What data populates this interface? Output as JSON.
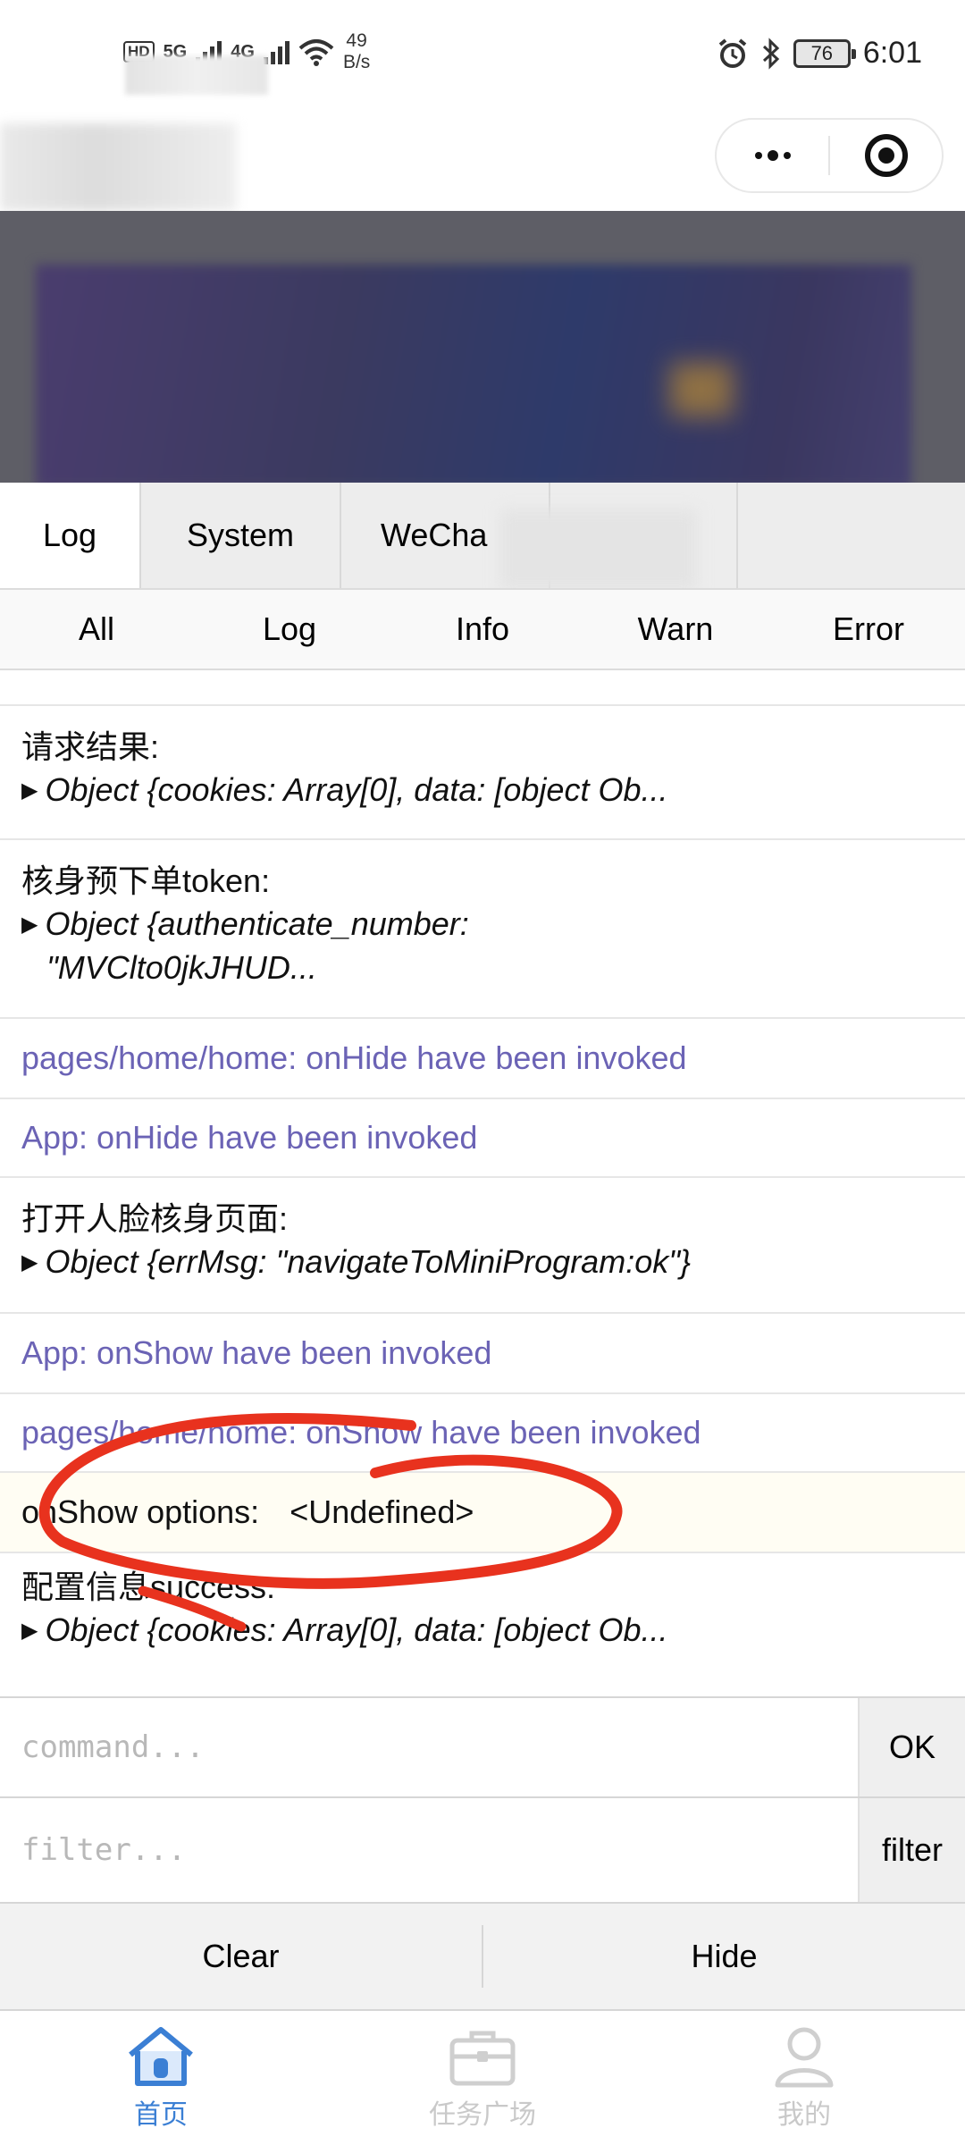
{
  "status_bar": {
    "hd1": "HD",
    "net1": "5G",
    "net2": "4G",
    "speed_value": "49",
    "speed_unit": "B/s",
    "battery": "76",
    "time": "6:01"
  },
  "capsule": {
    "more_icon": "more-dots-icon",
    "close_icon": "target-circle-icon"
  },
  "vconsole": {
    "tabs": [
      {
        "label": "Log"
      },
      {
        "label": "System"
      },
      {
        "label": "WeCha"
      }
    ],
    "filters": [
      "All",
      "Log",
      "Info",
      "Warn",
      "Error"
    ],
    "entries": [
      {
        "label": "请求结果:",
        "object": "Object {cookies: Array[0], data: [object Ob..."
      },
      {
        "label": "核身预下单token:",
        "object_line1": "Object {authenticate_number:",
        "object_line2": "\"MVClto0jkJHUD..."
      },
      {
        "text": "pages/home/home: onHide have been invoked"
      },
      {
        "text": "App: onHide have been invoked"
      },
      {
        "label": "打开人脸核身页面:",
        "object": "Object {errMsg: \"navigateToMiniProgram:ok\"}"
      },
      {
        "text": "App: onShow have been invoked"
      },
      {
        "text": "pages/home/home: onShow have been invoked"
      },
      {
        "label": "onShow options:",
        "value": "<Undefined>"
      },
      {
        "label": "配置信息success:",
        "object": "Object {cookies: Array[0], data: [object Ob..."
      }
    ],
    "command_placeholder": "command...",
    "ok_label": "OK",
    "filter_placeholder": "filter...",
    "filter_label": "filter",
    "clear_label": "Clear",
    "hide_label": "Hide"
  },
  "tabbar": [
    {
      "label": "首页",
      "icon": "home-icon"
    },
    {
      "label": "任务广场",
      "icon": "briefcase-icon"
    },
    {
      "label": "我的",
      "icon": "user-icon"
    }
  ],
  "colors": {
    "system_log": "#6b63b5",
    "annotation": "#e8321e",
    "tab_active": "#3b7fd4"
  }
}
